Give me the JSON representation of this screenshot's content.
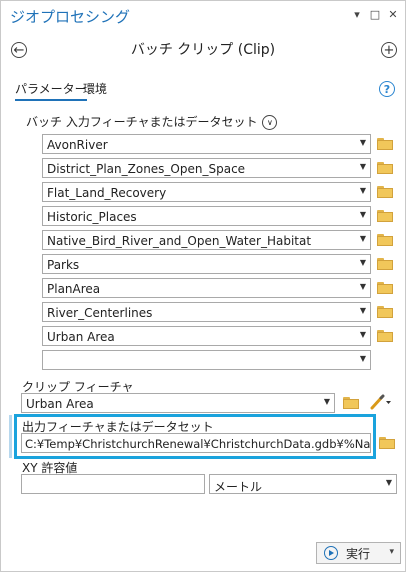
{
  "pane": {
    "title": "ジオプロセシング",
    "ctrl_pin": "▾",
    "ctrl_max": "□",
    "ctrl_close": "✕"
  },
  "tool": {
    "title": "バッチ クリップ (Clip)",
    "back_icon": "←",
    "add_icon": "+"
  },
  "tabs": [
    {
      "label": "パラメーター",
      "active": true
    },
    {
      "label": "環境",
      "active": false
    }
  ],
  "help_icon": "?",
  "batch_input": {
    "label": "バッチ 入力フィーチャまたはデータセット",
    "chevron_icon": "∨",
    "items": [
      "AvonRiver",
      "District_Plan_Zones_Open_Space",
      "Flat_Land_Recovery",
      "Historic_Places",
      "Native_Bird_River_and_Open_Water_Habitat",
      "Parks",
      "PlanArea",
      "River_Centerlines",
      "Urban Area",
      ""
    ]
  },
  "clip_features": {
    "label": "クリップ フィーチャ",
    "value": "Urban Area"
  },
  "output": {
    "label": "出力フィーチャまたはデータセット",
    "value": "C:¥Temp¥ChristchurchRenewal¥ChristchurchData.gdb¥%Name%"
  },
  "xy_tolerance": {
    "label": "XY 許容値",
    "value": "",
    "unit": "メートル"
  },
  "run_button": {
    "label": "実行",
    "menu_icon": "▾"
  },
  "colors": {
    "accent": "#1f72b8",
    "highlight": "#1aa3dd",
    "folder": "#f1c75a"
  }
}
